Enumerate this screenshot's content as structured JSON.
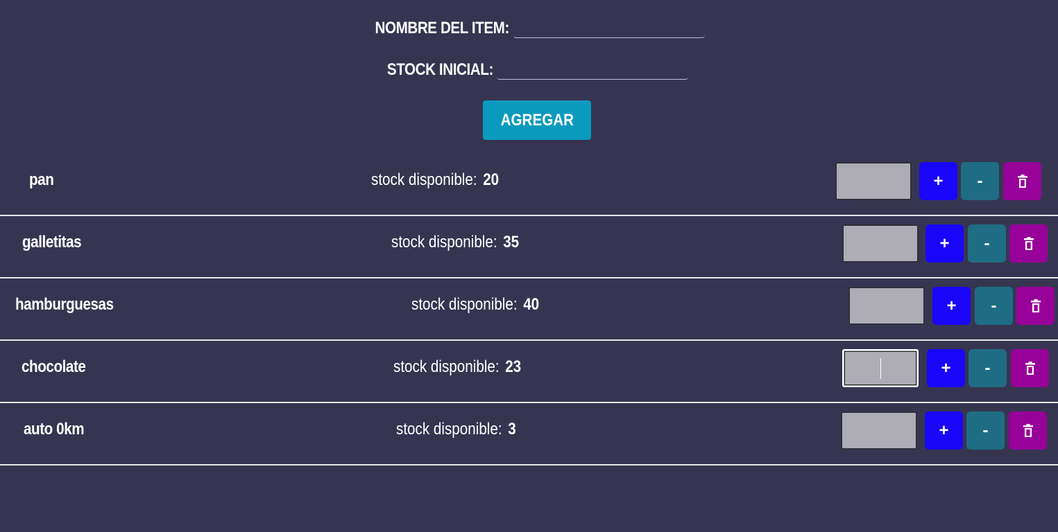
{
  "form": {
    "nombre_label": "NOMBRE DEL ITEM:",
    "nombre_value": "",
    "stock_label": "STOCK INICIAL:",
    "stock_value": "",
    "add_label": "AGREGAR"
  },
  "items": [
    {
      "name": "pan",
      "stock_label": "stock disponible:",
      "stock": "20",
      "plus": "+",
      "minus": "-"
    },
    {
      "name": "galletitas",
      "stock_label": "stock disponible:",
      "stock": "35",
      "plus": "+",
      "minus": "-"
    },
    {
      "name": "hamburguesas",
      "stock_label": "stock disponible:",
      "stock": "40",
      "plus": "+",
      "minus": "-"
    },
    {
      "name": "chocolate",
      "stock_label": "stock disponible:",
      "stock": "23",
      "plus": "+",
      "minus": "-"
    },
    {
      "name": "auto 0km",
      "stock_label": "stock disponible:",
      "stock": "3",
      "plus": "+",
      "minus": "-"
    }
  ],
  "colors": {
    "background": "#363551",
    "add_button": "#0a9abd",
    "plus_button": "#1a06f8",
    "minus_button": "#1f6d84",
    "delete_button": "#970099",
    "qty_input": "#aeadb6"
  },
  "icons": {
    "delete": "trash-icon"
  }
}
